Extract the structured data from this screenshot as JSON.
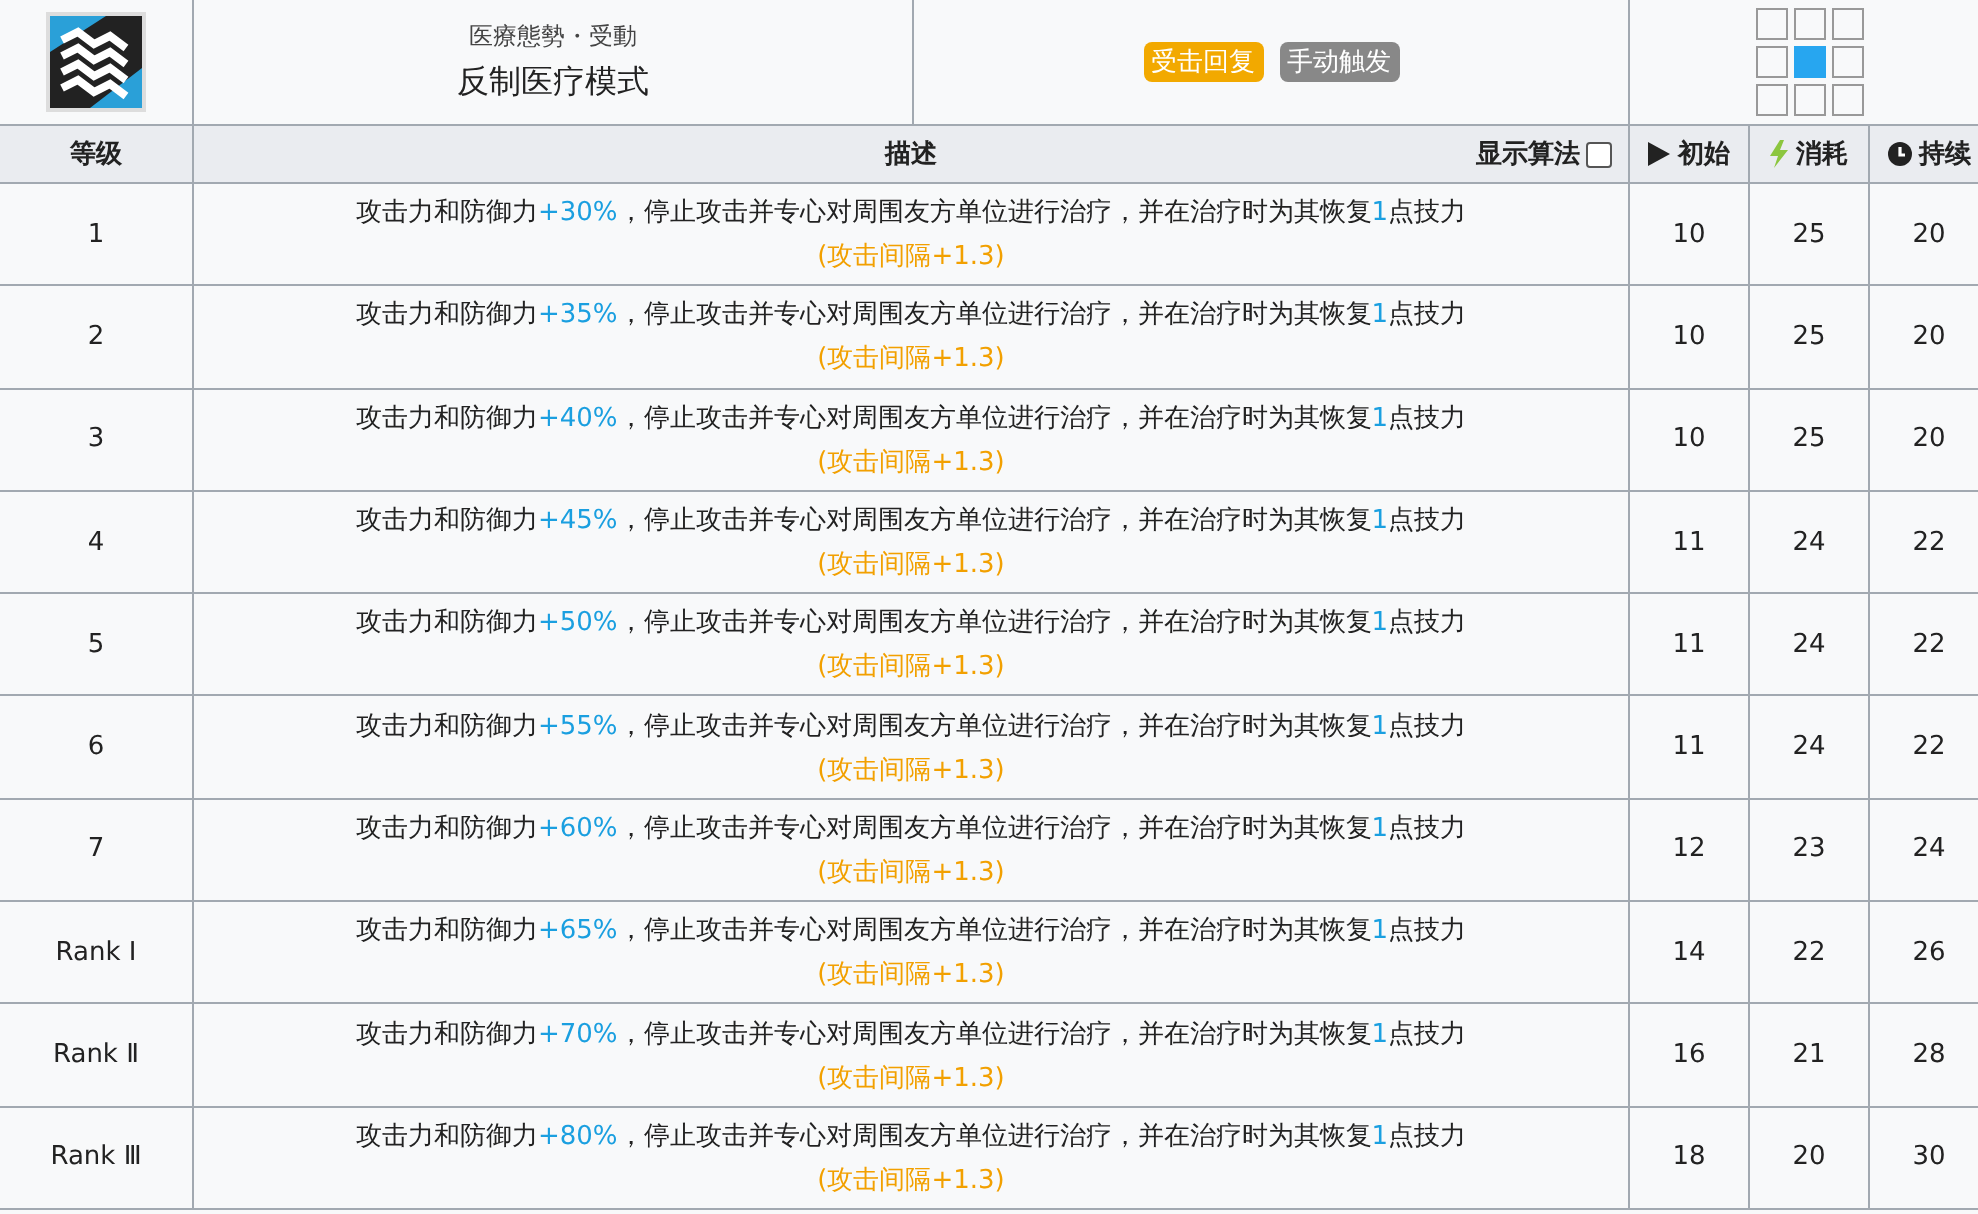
{
  "skill": {
    "subtitle": "医療態勢・受動",
    "name": "反制医疗模式",
    "tags": [
      {
        "label": "受击回复",
        "color": "#f2a900"
      },
      {
        "label": "手动触发",
        "color": "#888888"
      }
    ],
    "range": [
      [
        {
          "filled": false
        },
        {
          "filled": false
        },
        {
          "filled": false
        }
      ],
      [
        {
          "filled": false
        },
        {
          "filled": true
        },
        {
          "filled": false
        }
      ],
      [
        {
          "filled": false
        },
        {
          "filled": false
        },
        {
          "filled": false
        }
      ]
    ]
  },
  "columns": {
    "level": "等级",
    "description": "描述",
    "formula_toggle": {
      "label": "显示算法",
      "checked": false
    },
    "initial": "初始",
    "cost": "消耗",
    "duration": "持续"
  },
  "rows": [
    {
      "level": "1",
      "description": [
        {
          "text": "攻击力和防御力",
          "kind": "plain"
        },
        {
          "text": "+30%",
          "kind": "value"
        },
        {
          "text": "，停止攻击并专心对周围友方单位进行治疗，并在治疗时为其恢复",
          "kind": "plain"
        },
        {
          "text": "1",
          "kind": "value"
        },
        {
          "text": "点技力",
          "kind": "plain"
        }
      ],
      "note": "(攻击间隔+1.3)",
      "initial": "10",
      "cost": "25",
      "duration": "20"
    },
    {
      "level": "2",
      "description": [
        {
          "text": "攻击力和防御力",
          "kind": "plain"
        },
        {
          "text": "+35%",
          "kind": "value"
        },
        {
          "text": "，停止攻击并专心对周围友方单位进行治疗，并在治疗时为其恢复",
          "kind": "plain"
        },
        {
          "text": "1",
          "kind": "value"
        },
        {
          "text": "点技力",
          "kind": "plain"
        }
      ],
      "note": "(攻击间隔+1.3)",
      "initial": "10",
      "cost": "25",
      "duration": "20"
    },
    {
      "level": "3",
      "description": [
        {
          "text": "攻击力和防御力",
          "kind": "plain"
        },
        {
          "text": "+40%",
          "kind": "value"
        },
        {
          "text": "，停止攻击并专心对周围友方单位进行治疗，并在治疗时为其恢复",
          "kind": "plain"
        },
        {
          "text": "1",
          "kind": "value"
        },
        {
          "text": "点技力",
          "kind": "plain"
        }
      ],
      "note": "(攻击间隔+1.3)",
      "initial": "10",
      "cost": "25",
      "duration": "20"
    },
    {
      "level": "4",
      "description": [
        {
          "text": "攻击力和防御力",
          "kind": "plain"
        },
        {
          "text": "+45%",
          "kind": "value"
        },
        {
          "text": "，停止攻击并专心对周围友方单位进行治疗，并在治疗时为其恢复",
          "kind": "plain"
        },
        {
          "text": "1",
          "kind": "value"
        },
        {
          "text": "点技力",
          "kind": "plain"
        }
      ],
      "note": "(攻击间隔+1.3)",
      "initial": "11",
      "cost": "24",
      "duration": "22"
    },
    {
      "level": "5",
      "description": [
        {
          "text": "攻击力和防御力",
          "kind": "plain"
        },
        {
          "text": "+50%",
          "kind": "value"
        },
        {
          "text": "，停止攻击并专心对周围友方单位进行治疗，并在治疗时为其恢复",
          "kind": "plain"
        },
        {
          "text": "1",
          "kind": "value"
        },
        {
          "text": "点技力",
          "kind": "plain"
        }
      ],
      "note": "(攻击间隔+1.3)",
      "initial": "11",
      "cost": "24",
      "duration": "22"
    },
    {
      "level": "6",
      "description": [
        {
          "text": "攻击力和防御力",
          "kind": "plain"
        },
        {
          "text": "+55%",
          "kind": "value"
        },
        {
          "text": "，停止攻击并专心对周围友方单位进行治疗，并在治疗时为其恢复",
          "kind": "plain"
        },
        {
          "text": "1",
          "kind": "value"
        },
        {
          "text": "点技力",
          "kind": "plain"
        }
      ],
      "note": "(攻击间隔+1.3)",
      "initial": "11",
      "cost": "24",
      "duration": "22"
    },
    {
      "level": "7",
      "description": [
        {
          "text": "攻击力和防御力",
          "kind": "plain"
        },
        {
          "text": "+60%",
          "kind": "value"
        },
        {
          "text": "，停止攻击并专心对周围友方单位进行治疗，并在治疗时为其恢复",
          "kind": "plain"
        },
        {
          "text": "1",
          "kind": "value"
        },
        {
          "text": "点技力",
          "kind": "plain"
        }
      ],
      "note": "(攻击间隔+1.3)",
      "initial": "12",
      "cost": "23",
      "duration": "24"
    },
    {
      "level": "Rank Ⅰ",
      "description": [
        {
          "text": "攻击力和防御力",
          "kind": "plain"
        },
        {
          "text": "+65%",
          "kind": "value"
        },
        {
          "text": "，停止攻击并专心对周围友方单位进行治疗，并在治疗时为其恢复",
          "kind": "plain"
        },
        {
          "text": "1",
          "kind": "value"
        },
        {
          "text": "点技力",
          "kind": "plain"
        }
      ],
      "note": "(攻击间隔+1.3)",
      "initial": "14",
      "cost": "22",
      "duration": "26"
    },
    {
      "level": "Rank Ⅱ",
      "description": [
        {
          "text": "攻击力和防御力",
          "kind": "plain"
        },
        {
          "text": "+70%",
          "kind": "value"
        },
        {
          "text": "，停止攻击并专心对周围友方单位进行治疗，并在治疗时为其恢复",
          "kind": "plain"
        },
        {
          "text": "1",
          "kind": "value"
        },
        {
          "text": "点技力",
          "kind": "plain"
        }
      ],
      "note": "(攻击间隔+1.3)",
      "initial": "16",
      "cost": "21",
      "duration": "28"
    },
    {
      "level": "Rank Ⅲ",
      "description": [
        {
          "text": "攻击力和防御力",
          "kind": "plain"
        },
        {
          "text": "+80%",
          "kind": "value"
        },
        {
          "text": "，停止攻击并专心对周围友方单位进行治疗，并在治疗时为其恢复",
          "kind": "plain"
        },
        {
          "text": "1",
          "kind": "value"
        },
        {
          "text": "点技力",
          "kind": "plain"
        }
      ],
      "note": "(攻击间隔+1.3)",
      "initial": "18",
      "cost": "20",
      "duration": "30"
    }
  ]
}
